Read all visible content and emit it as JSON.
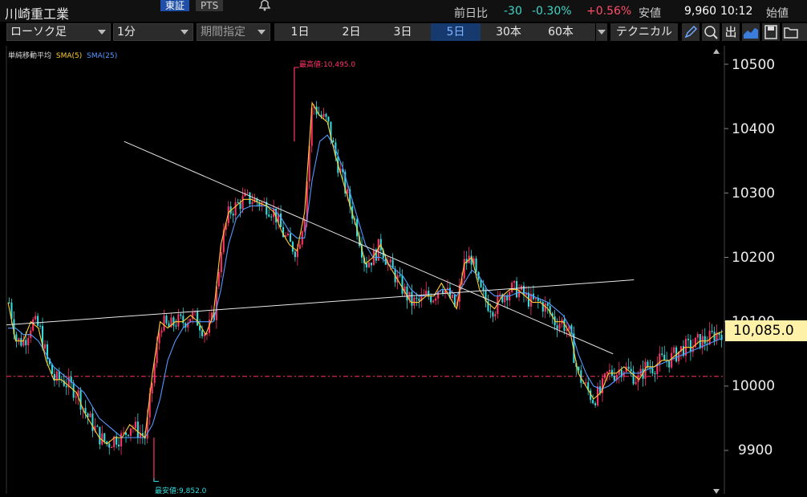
{
  "header": {
    "title": "川崎重工業",
    "markets": [
      "東証",
      "PTS"
    ],
    "quote": {
      "prev_label": "前日比",
      "change": "-30",
      "change_pct": "-0.30%",
      "high_pct": "+0.56%",
      "low_label": "安値",
      "price": "9,960",
      "time": "10:12",
      "open_label": "始値"
    }
  },
  "toolbar": {
    "chart_type": "ローソク足",
    "interval": "1分",
    "range_label": "期間指定",
    "periods": [
      "1日",
      "2日",
      "3日",
      "5日",
      "30本",
      "60本"
    ],
    "selected_period": "5日",
    "technical_label": "テクニカル",
    "out_label": "出"
  },
  "chart": {
    "legend": {
      "title": "単純移動平均",
      "sma5": "SMA(5)",
      "sma25": "SMA(25)"
    },
    "high_label": "最高値:10,495.0",
    "low_label": "最安値:9,852.0",
    "current_price_label": "10,085.0",
    "colors": {
      "up": "#ff3366",
      "down": "#33dddd",
      "sma5": "#ffcc33",
      "sma25": "#5599ff",
      "hline": "#ff3366",
      "label_bg": "#fff2a8"
    }
  },
  "chart_data": {
    "type": "line",
    "y_ticks": [
      "10500",
      "10400",
      "10300",
      "10200",
      "10100",
      "10000",
      "9900"
    ],
    "y_tick_values": [
      10500,
      10400,
      10300,
      10200,
      10100,
      10000,
      9900
    ],
    "ylim": [
      9830,
      10540
    ],
    "reference_price": 10015,
    "current_price": 10085,
    "high": 10495,
    "low": 9852,
    "series": [
      {
        "name": "SMA(5)",
        "values": [
          10130,
          10070,
          10070,
          10100,
          10090,
          10040,
          10010,
          10010,
          10000,
          9990,
          9960,
          9940,
          9920,
          9910,
          9920,
          9920,
          9940,
          9930,
          9920,
          10020,
          10100,
          10090,
          10100,
          10100,
          10110,
          10100,
          10080,
          10110,
          10220,
          10270,
          10280,
          10290,
          10290,
          10285,
          10280,
          10270,
          10240,
          10220,
          10210,
          10270,
          10440,
          10420,
          10410,
          10360,
          10320,
          10280,
          10240,
          10190,
          10200,
          10220,
          10190,
          10170,
          10150,
          10130,
          10130,
          10140,
          10140,
          10160,
          10140,
          10120,
          10190,
          10200,
          10150,
          10130,
          10120,
          10140,
          10150,
          10150,
          10140,
          10130,
          10130,
          10120,
          10100,
          10100,
          10080,
          10020,
          10000,
          9980,
          9990,
          10020,
          10020,
          10030,
          10020,
          10010,
          10030,
          10030,
          10040,
          10040,
          10050,
          10060,
          10060,
          10070,
          10070,
          10080,
          10085
        ]
      },
      {
        "name": "SMA(25)",
        "values": [
          10090,
          10090,
          10080,
          10080,
          10070,
          10050,
          10030,
          10020,
          10010,
          10000,
          9990,
          9970,
          9950,
          9940,
          9930,
          9920,
          9920,
          9920,
          9920,
          9940,
          9980,
          10040,
          10070,
          10090,
          10100,
          10100,
          10100,
          10100,
          10150,
          10220,
          10260,
          10275,
          10280,
          10280,
          10280,
          10275,
          10260,
          10240,
          10230,
          10230,
          10320,
          10380,
          10390,
          10370,
          10340,
          10300,
          10260,
          10220,
          10200,
          10200,
          10190,
          10180,
          10170,
          10150,
          10140,
          10140,
          10140,
          10150,
          10150,
          10140,
          10160,
          10180,
          10170,
          10150,
          10140,
          10140,
          10140,
          10145,
          10145,
          10140,
          10135,
          10130,
          10120,
          10110,
          10090,
          10050,
          10020,
          10000,
          9995,
          10000,
          10010,
          10020,
          10020,
          10020,
          10025,
          10030,
          10035,
          10040,
          10045,
          10050,
          10055,
          10060,
          10065,
          10070,
          10075
        ]
      }
    ],
    "trendlines": [
      {
        "from": [
          0.164,
          10380
        ],
        "to": [
          0.845,
          10050
        ]
      },
      {
        "from": [
          0.0,
          10095
        ],
        "to": [
          0.874,
          10165
        ]
      }
    ]
  }
}
